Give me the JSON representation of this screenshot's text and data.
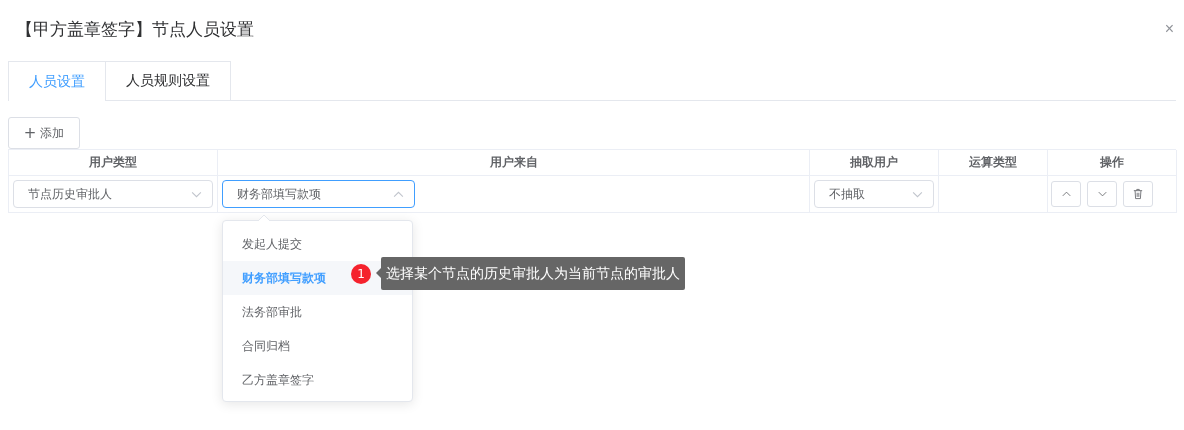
{
  "dialog": {
    "title": "【甲方盖章签字】节点人员设置",
    "close": "×"
  },
  "tabs": [
    {
      "label": "人员设置",
      "selected": true
    },
    {
      "label": "人员规则设置",
      "selected": false
    }
  ],
  "add_button": {
    "icon": "+",
    "label": "添加"
  },
  "table": {
    "columns": [
      "用户类型",
      "用户来自",
      "抽取用户",
      "运算类型",
      "操作"
    ],
    "rows": [
      {
        "user_type": "节点历史审批人",
        "user_from": {
          "value": "财务部填写款项",
          "expanded": true
        },
        "extract": "不抽取"
      }
    ]
  },
  "dropdown": {
    "options": [
      {
        "label": "发起人提交",
        "selected": false
      },
      {
        "label": "财务部填写款项",
        "selected": true
      },
      {
        "label": "法务部审批",
        "selected": false
      },
      {
        "label": "合同归档",
        "selected": false
      },
      {
        "label": "乙方盖章签字",
        "selected": false
      }
    ]
  },
  "hint": {
    "badge": "1",
    "text": "选择某个节点的历史审批人为当前节点的审批人"
  }
}
